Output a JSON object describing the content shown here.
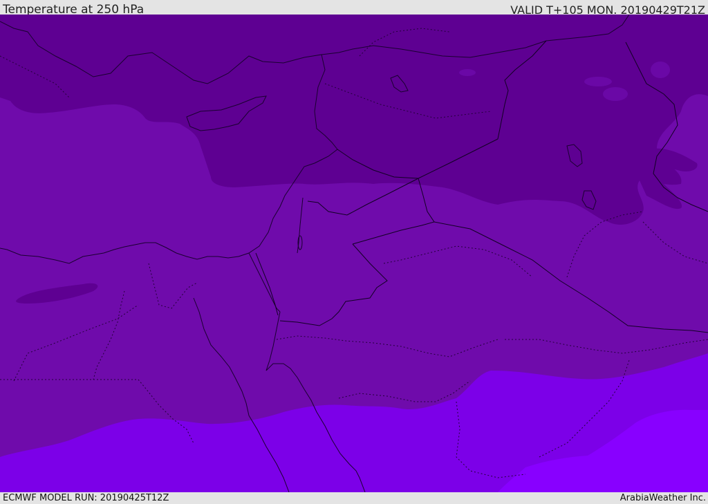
{
  "header": {
    "title": "Temperature at 250 hPa",
    "valid": "VALID T+105 MON. 20190429T21Z"
  },
  "footer": {
    "model_run": "ECMWF MODEL RUN: 20190425T12Z",
    "credit": "ArabiaWeather Inc."
  },
  "map": {
    "field": "temperature",
    "level": "250 hPa",
    "region": "Eastern Mediterranean, Levant, Egypt, Arabian Peninsula",
    "colors": {
      "coldest_band": "#5e0090",
      "cold_band": "#6e0aa8",
      "mid_band": "#7a10c2",
      "warm_band": "#8000ec",
      "warmest_band": "#8a00ff",
      "coastline": "#1a0030",
      "border": "#120024"
    }
  }
}
